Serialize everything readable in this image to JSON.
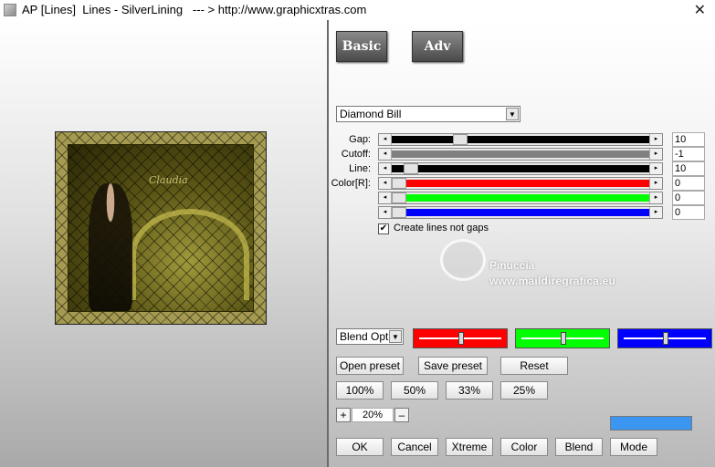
{
  "window": {
    "title": "AP [Lines]  Lines - SilverLining   --- > http://www.graphicxtras.com",
    "close_glyph": "✕"
  },
  "tabs": {
    "basic": "Basic",
    "adv": "Adv"
  },
  "preset": {
    "value": "Diamond Bill"
  },
  "sliders": [
    {
      "label": "Gap:",
      "value": "10",
      "level": 0.25,
      "color": "#000000"
    },
    {
      "label": "Cutoff:",
      "value": "-1",
      "level": null,
      "color": "#808080"
    },
    {
      "label": "Line:",
      "value": "10",
      "level": 0.05,
      "color": "#000000"
    },
    {
      "label": "Color[R]:",
      "value": "0",
      "level": 0.0,
      "color": "#ff0000"
    },
    {
      "label": "",
      "value": "0",
      "level": 0.0,
      "color": "#00ff00"
    },
    {
      "label": "",
      "value": "0",
      "level": 0.0,
      "color": "#0000ff"
    }
  ],
  "checkbox": {
    "label": "Create lines not gaps",
    "checked": true
  },
  "watermark": {
    "line1": "Pinuccia",
    "line2": "www.maildiregrafica.eu"
  },
  "blend": {
    "value": "Blend Optio"
  },
  "color_sliders": [
    {
      "color": "#ff0000",
      "level": 0.5
    },
    {
      "color": "#00ff00",
      "level": 0.5
    },
    {
      "color": "#0000ff",
      "level": 0.5
    }
  ],
  "buttons": {
    "open_preset": "Open preset",
    "save_preset": "Save preset",
    "reset": "Reset",
    "zoom_100": "100%",
    "zoom_50": "50%",
    "zoom_33": "33%",
    "zoom_25": "25%",
    "plus": "+",
    "minus": "–",
    "ok": "OK",
    "cancel": "Cancel",
    "xtreme": "Xtreme",
    "color": "Color",
    "blend": "Blend",
    "mode": "Mode"
  },
  "zoom": {
    "value": "20%"
  },
  "swatch_color": "#3a96f0",
  "preview": {
    "signature": "Claudia"
  }
}
